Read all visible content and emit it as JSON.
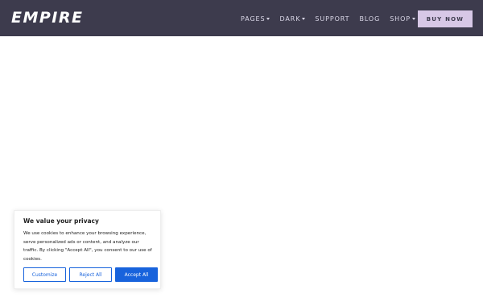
{
  "header": {
    "logo": "EMPIRE",
    "nav": [
      {
        "label": "PAGES",
        "has_dropdown": true
      },
      {
        "label": "DARK",
        "has_dropdown": true
      },
      {
        "label": "SUPPORT",
        "has_dropdown": false
      },
      {
        "label": "BLOG",
        "has_dropdown": false
      },
      {
        "label": "SHOP",
        "has_dropdown": true
      }
    ],
    "cta": "BUY NOW"
  },
  "cookie_banner": {
    "title": "We value your privacy",
    "text": "We use cookies to enhance your browsing experience, serve personalized ads or content, and analyze our traffic. By clicking \"Accept All\", you consent to our use of cookies.",
    "buttons": {
      "customize": "Customize",
      "reject": "Reject All",
      "accept": "Accept All"
    }
  },
  "colors": {
    "header_bg": "#3d3b4d",
    "cta_bg": "#d7c8e6",
    "accent_blue": "#1863dc"
  }
}
